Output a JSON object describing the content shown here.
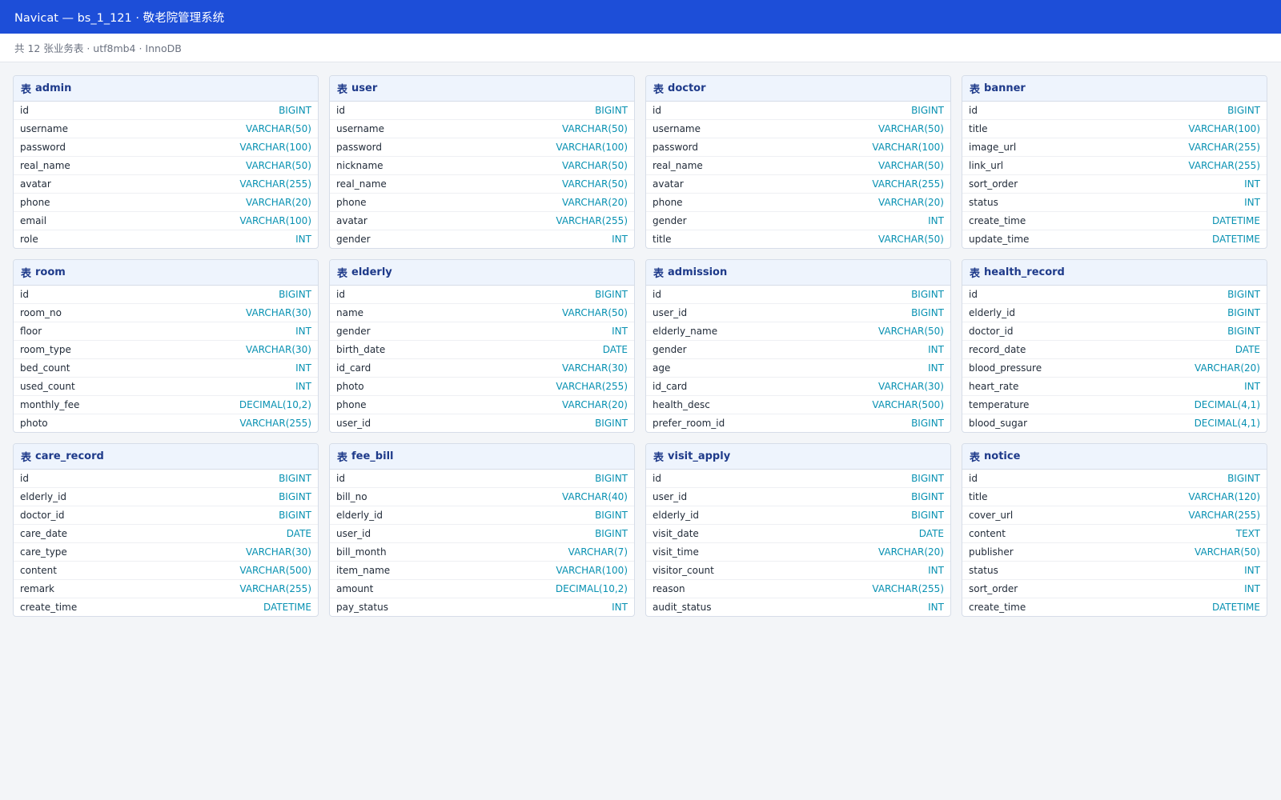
{
  "window": {
    "title": "Navicat — bs_1_121 · 敬老院管理系统"
  },
  "infobar": {
    "text": "共 12 张业务表 · utf8mb4 · InnoDB"
  },
  "table_prefix": "表",
  "colors": {
    "title_bar": "#1d4ed8",
    "header_text": "#1e3a8a",
    "type_text": "#0891b2",
    "header_bg": "#eef4fd"
  },
  "tables": [
    {
      "name": "admin",
      "columns": [
        {
          "name": "id",
          "type": "BIGINT"
        },
        {
          "name": "username",
          "type": "VARCHAR(50)"
        },
        {
          "name": "password",
          "type": "VARCHAR(100)"
        },
        {
          "name": "real_name",
          "type": "VARCHAR(50)"
        },
        {
          "name": "avatar",
          "type": "VARCHAR(255)"
        },
        {
          "name": "phone",
          "type": "VARCHAR(20)"
        },
        {
          "name": "email",
          "type": "VARCHAR(100)"
        },
        {
          "name": "role",
          "type": "INT"
        }
      ]
    },
    {
      "name": "user",
      "columns": [
        {
          "name": "id",
          "type": "BIGINT"
        },
        {
          "name": "username",
          "type": "VARCHAR(50)"
        },
        {
          "name": "password",
          "type": "VARCHAR(100)"
        },
        {
          "name": "nickname",
          "type": "VARCHAR(50)"
        },
        {
          "name": "real_name",
          "type": "VARCHAR(50)"
        },
        {
          "name": "phone",
          "type": "VARCHAR(20)"
        },
        {
          "name": "avatar",
          "type": "VARCHAR(255)"
        },
        {
          "name": "gender",
          "type": "INT"
        }
      ]
    },
    {
      "name": "doctor",
      "columns": [
        {
          "name": "id",
          "type": "BIGINT"
        },
        {
          "name": "username",
          "type": "VARCHAR(50)"
        },
        {
          "name": "password",
          "type": "VARCHAR(100)"
        },
        {
          "name": "real_name",
          "type": "VARCHAR(50)"
        },
        {
          "name": "avatar",
          "type": "VARCHAR(255)"
        },
        {
          "name": "phone",
          "type": "VARCHAR(20)"
        },
        {
          "name": "gender",
          "type": "INT"
        },
        {
          "name": "title",
          "type": "VARCHAR(50)"
        }
      ]
    },
    {
      "name": "banner",
      "columns": [
        {
          "name": "id",
          "type": "BIGINT"
        },
        {
          "name": "title",
          "type": "VARCHAR(100)"
        },
        {
          "name": "image_url",
          "type": "VARCHAR(255)"
        },
        {
          "name": "link_url",
          "type": "VARCHAR(255)"
        },
        {
          "name": "sort_order",
          "type": "INT"
        },
        {
          "name": "status",
          "type": "INT"
        },
        {
          "name": "create_time",
          "type": "DATETIME"
        },
        {
          "name": "update_time",
          "type": "DATETIME"
        }
      ]
    },
    {
      "name": "room",
      "columns": [
        {
          "name": "id",
          "type": "BIGINT"
        },
        {
          "name": "room_no",
          "type": "VARCHAR(30)"
        },
        {
          "name": "floor",
          "type": "INT"
        },
        {
          "name": "room_type",
          "type": "VARCHAR(30)"
        },
        {
          "name": "bed_count",
          "type": "INT"
        },
        {
          "name": "used_count",
          "type": "INT"
        },
        {
          "name": "monthly_fee",
          "type": "DECIMAL(10,2)"
        },
        {
          "name": "photo",
          "type": "VARCHAR(255)"
        }
      ]
    },
    {
      "name": "elderly",
      "columns": [
        {
          "name": "id",
          "type": "BIGINT"
        },
        {
          "name": "name",
          "type": "VARCHAR(50)"
        },
        {
          "name": "gender",
          "type": "INT"
        },
        {
          "name": "birth_date",
          "type": "DATE"
        },
        {
          "name": "id_card",
          "type": "VARCHAR(30)"
        },
        {
          "name": "photo",
          "type": "VARCHAR(255)"
        },
        {
          "name": "phone",
          "type": "VARCHAR(20)"
        },
        {
          "name": "user_id",
          "type": "BIGINT"
        }
      ]
    },
    {
      "name": "admission",
      "columns": [
        {
          "name": "id",
          "type": "BIGINT"
        },
        {
          "name": "user_id",
          "type": "BIGINT"
        },
        {
          "name": "elderly_name",
          "type": "VARCHAR(50)"
        },
        {
          "name": "gender",
          "type": "INT"
        },
        {
          "name": "age",
          "type": "INT"
        },
        {
          "name": "id_card",
          "type": "VARCHAR(30)"
        },
        {
          "name": "health_desc",
          "type": "VARCHAR(500)"
        },
        {
          "name": "prefer_room_id",
          "type": "BIGINT"
        }
      ]
    },
    {
      "name": "health_record",
      "columns": [
        {
          "name": "id",
          "type": "BIGINT"
        },
        {
          "name": "elderly_id",
          "type": "BIGINT"
        },
        {
          "name": "doctor_id",
          "type": "BIGINT"
        },
        {
          "name": "record_date",
          "type": "DATE"
        },
        {
          "name": "blood_pressure",
          "type": "VARCHAR(20)"
        },
        {
          "name": "heart_rate",
          "type": "INT"
        },
        {
          "name": "temperature",
          "type": "DECIMAL(4,1)"
        },
        {
          "name": "blood_sugar",
          "type": "DECIMAL(4,1)"
        }
      ]
    },
    {
      "name": "care_record",
      "columns": [
        {
          "name": "id",
          "type": "BIGINT"
        },
        {
          "name": "elderly_id",
          "type": "BIGINT"
        },
        {
          "name": "doctor_id",
          "type": "BIGINT"
        },
        {
          "name": "care_date",
          "type": "DATE"
        },
        {
          "name": "care_type",
          "type": "VARCHAR(30)"
        },
        {
          "name": "content",
          "type": "VARCHAR(500)"
        },
        {
          "name": "remark",
          "type": "VARCHAR(255)"
        },
        {
          "name": "create_time",
          "type": "DATETIME"
        }
      ]
    },
    {
      "name": "fee_bill",
      "columns": [
        {
          "name": "id",
          "type": "BIGINT"
        },
        {
          "name": "bill_no",
          "type": "VARCHAR(40)"
        },
        {
          "name": "elderly_id",
          "type": "BIGINT"
        },
        {
          "name": "user_id",
          "type": "BIGINT"
        },
        {
          "name": "bill_month",
          "type": "VARCHAR(7)"
        },
        {
          "name": "item_name",
          "type": "VARCHAR(100)"
        },
        {
          "name": "amount",
          "type": "DECIMAL(10,2)"
        },
        {
          "name": "pay_status",
          "type": "INT"
        }
      ]
    },
    {
      "name": "visit_apply",
      "columns": [
        {
          "name": "id",
          "type": "BIGINT"
        },
        {
          "name": "user_id",
          "type": "BIGINT"
        },
        {
          "name": "elderly_id",
          "type": "BIGINT"
        },
        {
          "name": "visit_date",
          "type": "DATE"
        },
        {
          "name": "visit_time",
          "type": "VARCHAR(20)"
        },
        {
          "name": "visitor_count",
          "type": "INT"
        },
        {
          "name": "reason",
          "type": "VARCHAR(255)"
        },
        {
          "name": "audit_status",
          "type": "INT"
        }
      ]
    },
    {
      "name": "notice",
      "columns": [
        {
          "name": "id",
          "type": "BIGINT"
        },
        {
          "name": "title",
          "type": "VARCHAR(120)"
        },
        {
          "name": "cover_url",
          "type": "VARCHAR(255)"
        },
        {
          "name": "content",
          "type": "TEXT"
        },
        {
          "name": "publisher",
          "type": "VARCHAR(50)"
        },
        {
          "name": "status",
          "type": "INT"
        },
        {
          "name": "sort_order",
          "type": "INT"
        },
        {
          "name": "create_time",
          "type": "DATETIME"
        }
      ]
    }
  ]
}
